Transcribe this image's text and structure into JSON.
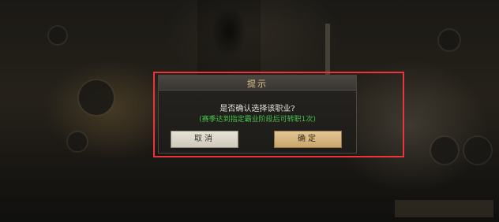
{
  "dialog": {
    "title": "提示",
    "question": "是否确认选择该职业?",
    "hint": "(赛季达到指定霸业阶段后可转职1次)",
    "cancel_label": "取消",
    "confirm_label": "确定"
  },
  "colors": {
    "highlight_border": "#e8343a",
    "hint_text": "#45c44a",
    "title_text": "#d9c28a"
  }
}
